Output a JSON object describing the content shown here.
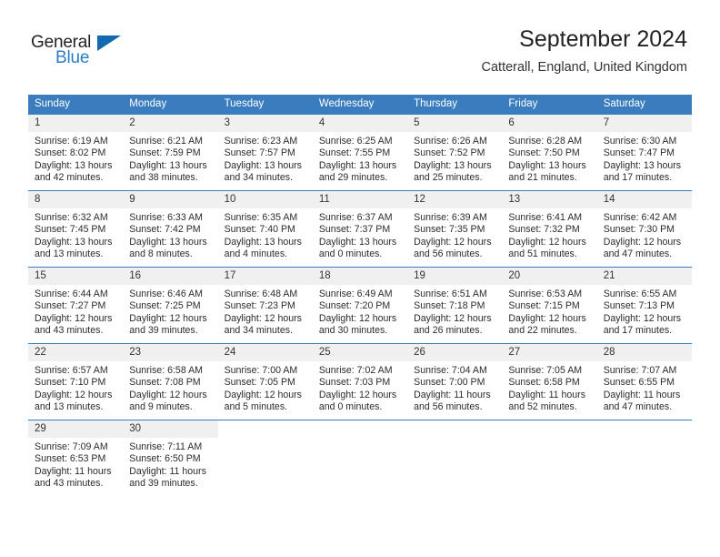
{
  "brand": {
    "name_top": "General",
    "name_bottom": "Blue",
    "accent_color": "#2b7dc3",
    "triangle_color": "#1269b0"
  },
  "header": {
    "title": "September 2024",
    "subtitle": "Catterall, England, United Kingdom"
  },
  "calendar": {
    "header_bg": "#3a7cbe",
    "daynum_bg": "#f0f0f0",
    "weekday_names": [
      "Sunday",
      "Monday",
      "Tuesday",
      "Wednesday",
      "Thursday",
      "Friday",
      "Saturday"
    ],
    "weeks": [
      [
        {
          "day": "1",
          "sunrise": "Sunrise: 6:19 AM",
          "sunset": "Sunset: 8:02 PM",
          "daylight_1": "Daylight: 13 hours",
          "daylight_2": "and 42 minutes."
        },
        {
          "day": "2",
          "sunrise": "Sunrise: 6:21 AM",
          "sunset": "Sunset: 7:59 PM",
          "daylight_1": "Daylight: 13 hours",
          "daylight_2": "and 38 minutes."
        },
        {
          "day": "3",
          "sunrise": "Sunrise: 6:23 AM",
          "sunset": "Sunset: 7:57 PM",
          "daylight_1": "Daylight: 13 hours",
          "daylight_2": "and 34 minutes."
        },
        {
          "day": "4",
          "sunrise": "Sunrise: 6:25 AM",
          "sunset": "Sunset: 7:55 PM",
          "daylight_1": "Daylight: 13 hours",
          "daylight_2": "and 29 minutes."
        },
        {
          "day": "5",
          "sunrise": "Sunrise: 6:26 AM",
          "sunset": "Sunset: 7:52 PM",
          "daylight_1": "Daylight: 13 hours",
          "daylight_2": "and 25 minutes."
        },
        {
          "day": "6",
          "sunrise": "Sunrise: 6:28 AM",
          "sunset": "Sunset: 7:50 PM",
          "daylight_1": "Daylight: 13 hours",
          "daylight_2": "and 21 minutes."
        },
        {
          "day": "7",
          "sunrise": "Sunrise: 6:30 AM",
          "sunset": "Sunset: 7:47 PM",
          "daylight_1": "Daylight: 13 hours",
          "daylight_2": "and 17 minutes."
        }
      ],
      [
        {
          "day": "8",
          "sunrise": "Sunrise: 6:32 AM",
          "sunset": "Sunset: 7:45 PM",
          "daylight_1": "Daylight: 13 hours",
          "daylight_2": "and 13 minutes."
        },
        {
          "day": "9",
          "sunrise": "Sunrise: 6:33 AM",
          "sunset": "Sunset: 7:42 PM",
          "daylight_1": "Daylight: 13 hours",
          "daylight_2": "and 8 minutes."
        },
        {
          "day": "10",
          "sunrise": "Sunrise: 6:35 AM",
          "sunset": "Sunset: 7:40 PM",
          "daylight_1": "Daylight: 13 hours",
          "daylight_2": "and 4 minutes."
        },
        {
          "day": "11",
          "sunrise": "Sunrise: 6:37 AM",
          "sunset": "Sunset: 7:37 PM",
          "daylight_1": "Daylight: 13 hours",
          "daylight_2": "and 0 minutes."
        },
        {
          "day": "12",
          "sunrise": "Sunrise: 6:39 AM",
          "sunset": "Sunset: 7:35 PM",
          "daylight_1": "Daylight: 12 hours",
          "daylight_2": "and 56 minutes."
        },
        {
          "day": "13",
          "sunrise": "Sunrise: 6:41 AM",
          "sunset": "Sunset: 7:32 PM",
          "daylight_1": "Daylight: 12 hours",
          "daylight_2": "and 51 minutes."
        },
        {
          "day": "14",
          "sunrise": "Sunrise: 6:42 AM",
          "sunset": "Sunset: 7:30 PM",
          "daylight_1": "Daylight: 12 hours",
          "daylight_2": "and 47 minutes."
        }
      ],
      [
        {
          "day": "15",
          "sunrise": "Sunrise: 6:44 AM",
          "sunset": "Sunset: 7:27 PM",
          "daylight_1": "Daylight: 12 hours",
          "daylight_2": "and 43 minutes."
        },
        {
          "day": "16",
          "sunrise": "Sunrise: 6:46 AM",
          "sunset": "Sunset: 7:25 PM",
          "daylight_1": "Daylight: 12 hours",
          "daylight_2": "and 39 minutes."
        },
        {
          "day": "17",
          "sunrise": "Sunrise: 6:48 AM",
          "sunset": "Sunset: 7:23 PM",
          "daylight_1": "Daylight: 12 hours",
          "daylight_2": "and 34 minutes."
        },
        {
          "day": "18",
          "sunrise": "Sunrise: 6:49 AM",
          "sunset": "Sunset: 7:20 PM",
          "daylight_1": "Daylight: 12 hours",
          "daylight_2": "and 30 minutes."
        },
        {
          "day": "19",
          "sunrise": "Sunrise: 6:51 AM",
          "sunset": "Sunset: 7:18 PM",
          "daylight_1": "Daylight: 12 hours",
          "daylight_2": "and 26 minutes."
        },
        {
          "day": "20",
          "sunrise": "Sunrise: 6:53 AM",
          "sunset": "Sunset: 7:15 PM",
          "daylight_1": "Daylight: 12 hours",
          "daylight_2": "and 22 minutes."
        },
        {
          "day": "21",
          "sunrise": "Sunrise: 6:55 AM",
          "sunset": "Sunset: 7:13 PM",
          "daylight_1": "Daylight: 12 hours",
          "daylight_2": "and 17 minutes."
        }
      ],
      [
        {
          "day": "22",
          "sunrise": "Sunrise: 6:57 AM",
          "sunset": "Sunset: 7:10 PM",
          "daylight_1": "Daylight: 12 hours",
          "daylight_2": "and 13 minutes."
        },
        {
          "day": "23",
          "sunrise": "Sunrise: 6:58 AM",
          "sunset": "Sunset: 7:08 PM",
          "daylight_1": "Daylight: 12 hours",
          "daylight_2": "and 9 minutes."
        },
        {
          "day": "24",
          "sunrise": "Sunrise: 7:00 AM",
          "sunset": "Sunset: 7:05 PM",
          "daylight_1": "Daylight: 12 hours",
          "daylight_2": "and 5 minutes."
        },
        {
          "day": "25",
          "sunrise": "Sunrise: 7:02 AM",
          "sunset": "Sunset: 7:03 PM",
          "daylight_1": "Daylight: 12 hours",
          "daylight_2": "and 0 minutes."
        },
        {
          "day": "26",
          "sunrise": "Sunrise: 7:04 AM",
          "sunset": "Sunset: 7:00 PM",
          "daylight_1": "Daylight: 11 hours",
          "daylight_2": "and 56 minutes."
        },
        {
          "day": "27",
          "sunrise": "Sunrise: 7:05 AM",
          "sunset": "Sunset: 6:58 PM",
          "daylight_1": "Daylight: 11 hours",
          "daylight_2": "and 52 minutes."
        },
        {
          "day": "28",
          "sunrise": "Sunrise: 7:07 AM",
          "sunset": "Sunset: 6:55 PM",
          "daylight_1": "Daylight: 11 hours",
          "daylight_2": "and 47 minutes."
        }
      ],
      [
        {
          "day": "29",
          "sunrise": "Sunrise: 7:09 AM",
          "sunset": "Sunset: 6:53 PM",
          "daylight_1": "Daylight: 11 hours",
          "daylight_2": "and 43 minutes."
        },
        {
          "day": "30",
          "sunrise": "Sunrise: 7:11 AM",
          "sunset": "Sunset: 6:50 PM",
          "daylight_1": "Daylight: 11 hours",
          "daylight_2": "and 39 minutes."
        },
        {
          "day": "",
          "sunrise": "",
          "sunset": "",
          "daylight_1": "",
          "daylight_2": ""
        },
        {
          "day": "",
          "sunrise": "",
          "sunset": "",
          "daylight_1": "",
          "daylight_2": ""
        },
        {
          "day": "",
          "sunrise": "",
          "sunset": "",
          "daylight_1": "",
          "daylight_2": ""
        },
        {
          "day": "",
          "sunrise": "",
          "sunset": "",
          "daylight_1": "",
          "daylight_2": ""
        },
        {
          "day": "",
          "sunrise": "",
          "sunset": "",
          "daylight_1": "",
          "daylight_2": ""
        }
      ]
    ]
  }
}
